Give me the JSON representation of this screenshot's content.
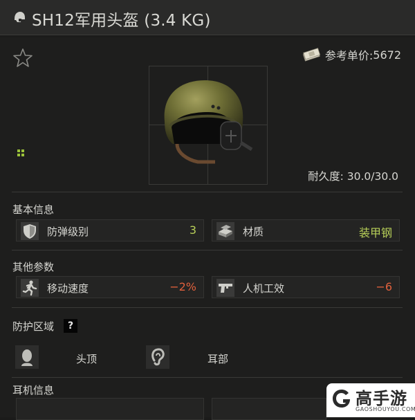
{
  "title": "SH12军用头盔 (3.4 KG)",
  "price": {
    "label": "参考单价:",
    "value": "5672"
  },
  "durability": {
    "label": "耐久度:",
    "value": "30.0/30.0"
  },
  "sections": {
    "basic": "基本信息",
    "other": "其他参数",
    "protection": "防护区域",
    "headset": "耳机信息"
  },
  "basic_stats": [
    {
      "icon": "shield-icon",
      "label": "防弹级别",
      "value": "3"
    },
    {
      "icon": "armor-material-icon",
      "label": "材质",
      "value": "装甲钢"
    }
  ],
  "other_stats": [
    {
      "icon": "running-man-icon",
      "label": "移动速度",
      "value": "−2%"
    },
    {
      "icon": "pistol-icon",
      "label": "人机工效",
      "value": "−6"
    }
  ],
  "protection_zones": [
    {
      "icon": "head-top-icon",
      "label": "头顶"
    },
    {
      "icon": "ear-icon",
      "label": "耳部"
    }
  ],
  "help_mark": "?",
  "watermark": {
    "name": "高手游",
    "url": "GAOSHOUYOU.COM"
  },
  "colors": {
    "positive": "#b7cf58",
    "negative": "#e0603c",
    "background": "#1b1b1a"
  }
}
